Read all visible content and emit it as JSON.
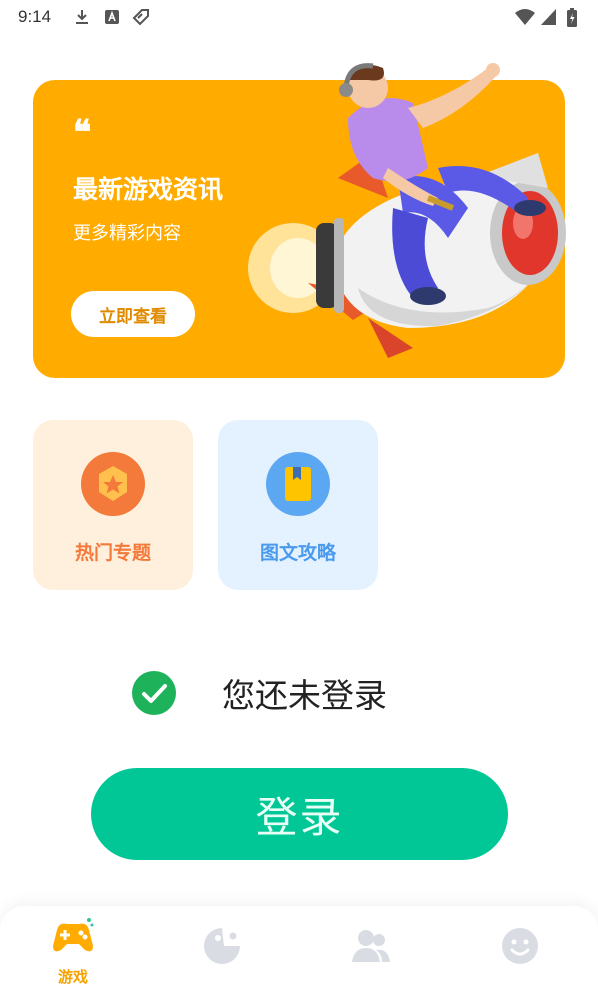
{
  "status_bar": {
    "time": "9:14"
  },
  "banner": {
    "quote_mark": "❝",
    "title": "最新游戏资讯",
    "subtitle": "更多精彩内容",
    "button_label": "立即查看",
    "bg_color": "#FFAB00"
  },
  "features": [
    {
      "label": "热门专题",
      "icon": "star-badge-icon",
      "color": "#F37A3A",
      "bg": "#FFF0DD"
    },
    {
      "label": "图文攻略",
      "icon": "book-icon",
      "color": "#4A9AEE",
      "bg": "#E4F1FF"
    }
  ],
  "login": {
    "status_text": "您还未登录",
    "button_label": "登录",
    "accent": "#00C795"
  },
  "bottom_nav": [
    {
      "label": "游戏",
      "icon": "gamepad-icon",
      "active": true
    },
    {
      "label": "",
      "icon": "pacman-icon",
      "active": false
    },
    {
      "label": "",
      "icon": "users-icon",
      "active": false
    },
    {
      "label": "",
      "icon": "smiley-icon",
      "active": false
    }
  ]
}
